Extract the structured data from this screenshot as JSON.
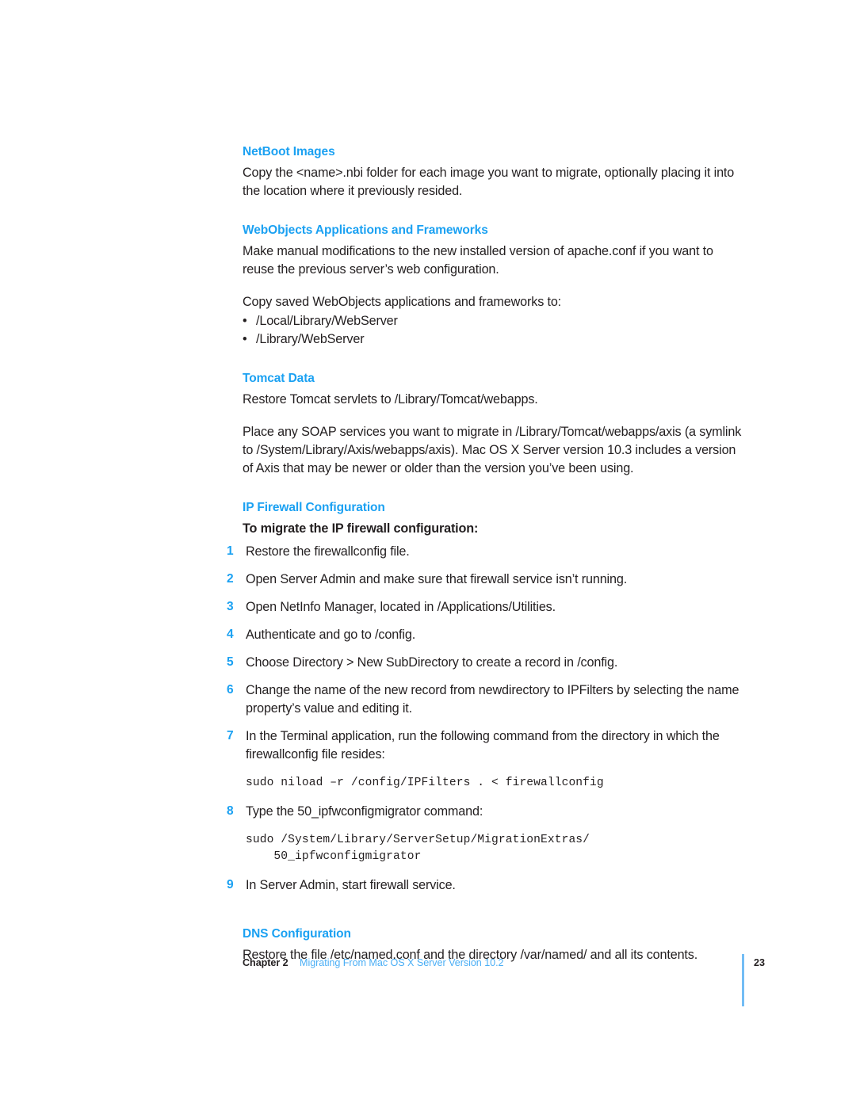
{
  "document": {
    "sections": [
      {
        "id": "netboot-images",
        "heading": "NetBoot Images",
        "paragraphs": [
          "Copy the <name>.nbi folder for each image you want to migrate, optionally placing it into the location where it previously resided."
        ]
      },
      {
        "id": "webobjects",
        "heading": "WebObjects Applications and Frameworks",
        "paragraphs": [
          "Make manual modifications to the new installed version of apache.conf if you want to reuse the previous server’s web configuration.",
          "Copy saved WebObjects applications and frameworks to:"
        ],
        "bullet_marker": "•",
        "bullets": [
          "/Local/Library/WebServer",
          "/Library/WebServer"
        ]
      },
      {
        "id": "tomcat-data",
        "heading": "Tomcat Data",
        "paragraphs": [
          "Restore Tomcat servlets to /Library/Tomcat/webapps.",
          "Place any SOAP services you want to migrate in /Library/Tomcat/webapps/axis (a symlink to /System/Library/Axis/webapps/axis). Mac OS X Server version 10.3 includes a version of Axis that may be newer or older than the version you’ve been using."
        ]
      },
      {
        "id": "ip-firewall-configuration",
        "heading": "IP Firewall Configuration",
        "task_lead": "To migrate the IP firewall configuration:",
        "steps": [
          {
            "num": "1",
            "text": "Restore the firewallconfig file."
          },
          {
            "num": "2",
            "text": "Open Server Admin and make sure that firewall service isn’t running."
          },
          {
            "num": "3",
            "text": "Open NetInfo Manager, located in /Applications/Utilities."
          },
          {
            "num": "4",
            "text": "Authenticate and go to /config."
          },
          {
            "num": "5",
            "text": "Choose Directory > New SubDirectory to create a record in /config."
          },
          {
            "num": "6",
            "text": "Change the name of the new record from newdirectory to IPFilters by selecting the name property’s value and editing it."
          },
          {
            "num": "7",
            "text": "In the Terminal application, run the following command from the directory in which the firewallconfig file resides:"
          },
          {
            "num": "8",
            "text": "Type the 50_ipfwconfigmigrator command:"
          },
          {
            "num": "9",
            "text": "In Server Admin, start firewall service."
          }
        ],
        "code_blocks": {
          "niload": "sudo niload –r /config/IPFilters . < firewallconfig",
          "migrator": "sudo /System/Library/ServerSetup/MigrationExtras/\n    50_ipfwconfigmigrator"
        }
      },
      {
        "id": "dns-configuration",
        "heading": "DNS Configuration",
        "paragraphs": [
          "Restore the file /etc/named.conf and the directory /var/named/ and all its contents."
        ]
      }
    ]
  },
  "footer": {
    "chapter_label": "Chapter 2",
    "chapter_title": "Migrating From Mac OS X Server Version 10.2",
    "page_number": "23"
  },
  "colors": {
    "heading_blue": "#1ba1f2",
    "footer_blue": "#4aaef5",
    "rule_blue": "#73bdf5",
    "body_black": "#231f20"
  }
}
